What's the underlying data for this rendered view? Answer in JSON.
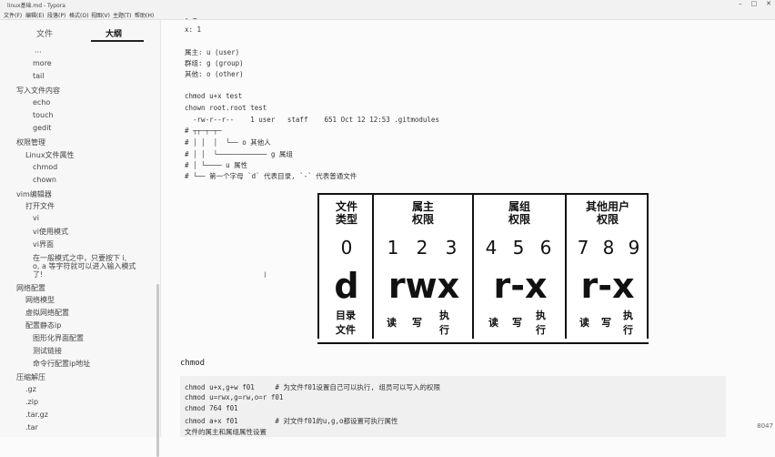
{
  "window": {
    "title": "linux基础.md - Typora"
  },
  "menu": [
    "文件(F)",
    "编辑(E)",
    "段落(P)",
    "格式(O)",
    "视图(V)",
    "主题(T)",
    "帮助(H)"
  ],
  "sidebar": {
    "tab_files": "文件",
    "tab_outline": "大纲",
    "items": [
      "···",
      "more",
      "tail",
      "写入文件内容",
      "echo",
      "touch",
      "gedit",
      "权限管理",
      "Linux文件属性",
      "chmod",
      "chown",
      "vim编辑器",
      "打开文件",
      "vi",
      "vi使用模式",
      "vi界面",
      "在一般模式之中，只要按下 i,",
      "o, a 等字符就可以进入输入模式",
      "了!",
      "网络配置",
      "网络模型",
      "虚拟网络配置",
      "配置静态ip",
      "图形化界面配置",
      "测试链接",
      "命令行配置ip地址",
      "压缩解压",
      ".gz",
      ".zip",
      ".tar.gz",
      ".tar"
    ]
  },
  "editor": {
    "top_lines": [
      "- ~",
      "x: 1",
      "",
      "属主: u (user)",
      "群组: g (group)",
      "其他: o (other)",
      "",
      "chmod u+x test",
      "chown root.root test"
    ],
    "tree_lines": [
      "  -rw-r--r--    1 user   staff    651 Oct 12 12:53 .gitmodules",
      "# ┬┬─┬─┬─",
      "# │ │  │  └── o 其他人",
      "# │ │  └──────────── g 属组",
      "# │ └──── u 属性",
      "# └── 第一个字母 `d` 代表目录, `-` 代表普通文件"
    ],
    "heading": "chmod",
    "code_lines": [
      "chmod u+x,g+w f01     # 为文件f01设置自己可以执行, 组员可以写入的权限",
      "chmod u=rwx,g=rw,o=r f01",
      "chmod 764 f01",
      "chmod a+x f01         # 对文件f01的u,g,o都设置可执行属性",
      "文件的属主和属组属性设置"
    ],
    "word_count": "8047"
  },
  "perm_table": {
    "c1": {
      "h1": "文件",
      "h2": "类型",
      "num": "0",
      "big": "d",
      "s1": "目录",
      "s2": "文件"
    },
    "c2": {
      "h1": "属主",
      "h2": "权限",
      "n1": "1",
      "n2": "2",
      "n3": "3",
      "big": "rwx",
      "s1": "读",
      "s2": "写",
      "s3a": "执",
      "s3b": "行"
    },
    "c3": {
      "h1": "属组",
      "h2": "权限",
      "n1": "4",
      "n2": "5",
      "n3": "6",
      "big": "r-x",
      "s1": "读",
      "s2": "写",
      "s3a": "执",
      "s3b": "行"
    },
    "c4": {
      "h1": "其他用户",
      "h2": "权限",
      "n1": "7",
      "n2": "8",
      "n3": "9",
      "big": "r-x",
      "s1": "读",
      "s2": "写",
      "s3a": "执",
      "s3b": "行"
    }
  }
}
